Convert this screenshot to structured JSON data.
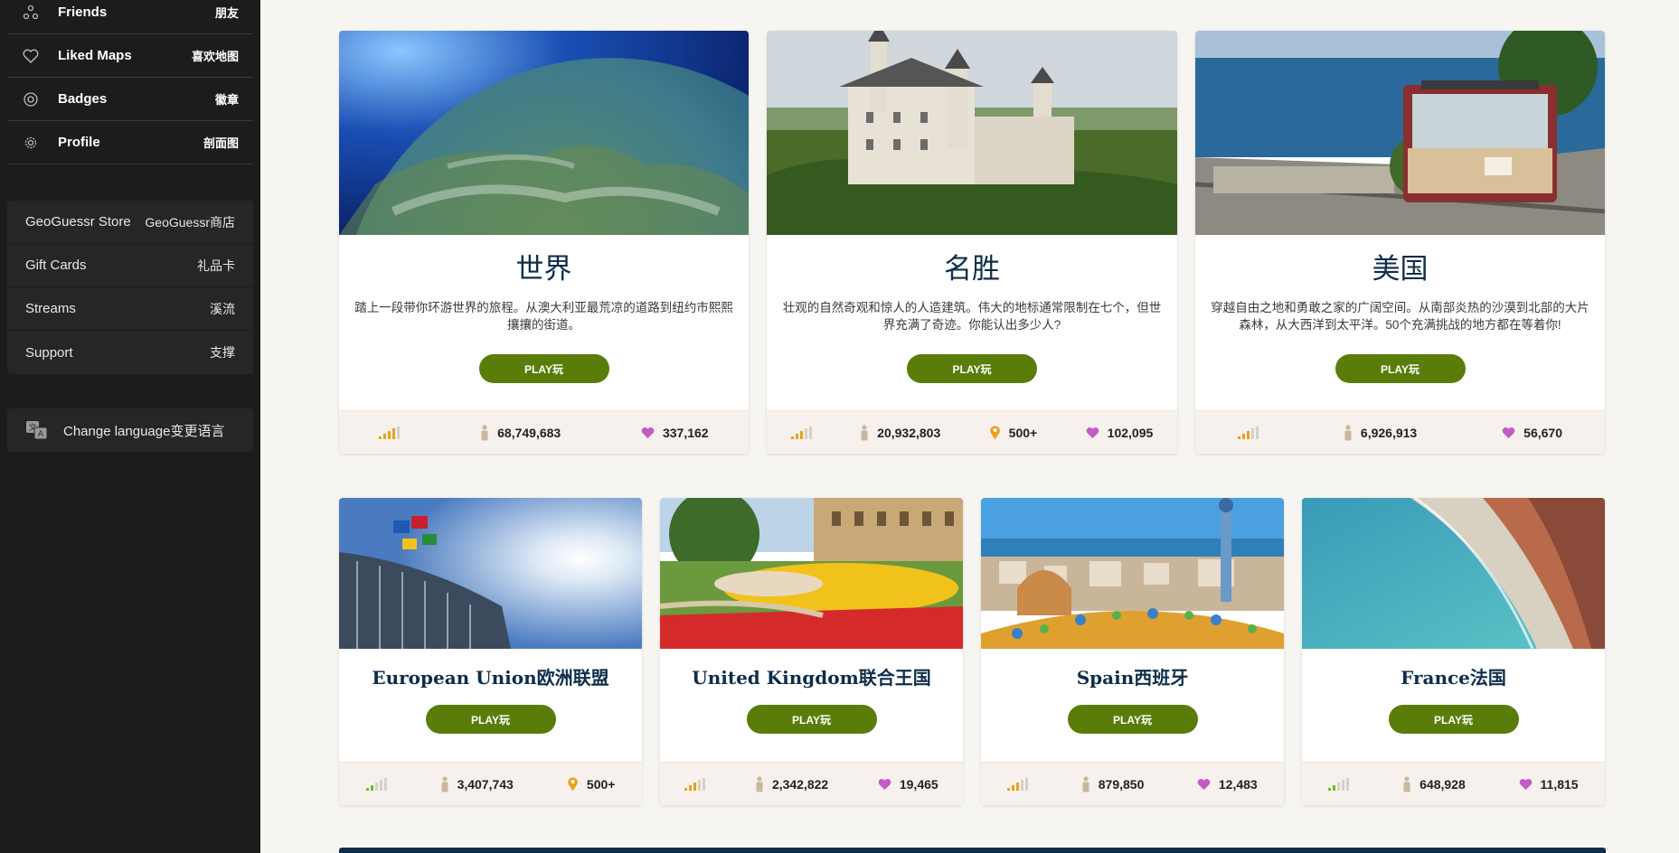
{
  "sidebar": {
    "nav": [
      {
        "label": "Friends",
        "cn": "朋友",
        "icon": "friends-icon"
      },
      {
        "label": "Liked Maps",
        "cn": "喜欢地图",
        "icon": "heart-outline-icon"
      },
      {
        "label": "Badges",
        "cn": "徽章",
        "icon": "badge-icon"
      },
      {
        "label": "Profile",
        "cn": "剖面图",
        "icon": "gear-icon"
      }
    ],
    "links": [
      {
        "label": "GeoGuessr Store",
        "cn": "GeoGuessr商店"
      },
      {
        "label": "Gift Cards",
        "cn": "礼品卡"
      },
      {
        "label": "Streams",
        "cn": "溪流"
      },
      {
        "label": "Support",
        "cn": "支撑"
      }
    ],
    "language": "Change language变更语言"
  },
  "cards": [
    {
      "title": "世界",
      "desc": "踏上一段带你环游世界的旅程。从澳大利亚最荒凉的道路到纽约市熙熙攘攘的街道。",
      "play": "PLAY玩",
      "plays": "68,749,683",
      "likes": "337,162",
      "difficulty": 3
    },
    {
      "title": "名胜",
      "desc": "壮观的自然奇观和惊人的人造建筑。伟大的地标通常限制在七个，但世界充满了奇迹。你能认出多少人?",
      "play": "PLAY玩",
      "plays": "20,932,803",
      "locations": "500+",
      "likes": "102,095",
      "difficulty": 3
    },
    {
      "title": "美国",
      "desc": "穿越自由之地和勇敢之家的广阔空间。从南部炎热的沙漠到北部的大片森林，从大西洋到太平洋。50个充满挑战的地方都在等着你!",
      "play": "PLAY玩",
      "plays": "6,926,913",
      "likes": "56,670",
      "difficulty": 3
    },
    {
      "title": "European Union欧洲联盟",
      "play": "PLAY玩",
      "plays": "3,407,743",
      "locations": "500+",
      "difficulty": 2
    },
    {
      "title": "United Kingdom联合王国",
      "play": "PLAY玩",
      "plays": "2,342,822",
      "likes": "19,465",
      "difficulty": 3
    },
    {
      "title": "Spain西班牙",
      "play": "PLAY玩",
      "plays": "879,850",
      "likes": "12,483",
      "difficulty": 3
    },
    {
      "title": "France法国",
      "play": "PLAY玩",
      "plays": "648,928",
      "likes": "11,815",
      "difficulty": 2
    }
  ],
  "colors": {
    "play": "#5a7d0a",
    "title": "#0f2d4a",
    "heart": "#c45bc4",
    "pin": "#e8a21c",
    "diffOrange": "#e8a21c",
    "diffGreen": "#6bbf1f"
  }
}
